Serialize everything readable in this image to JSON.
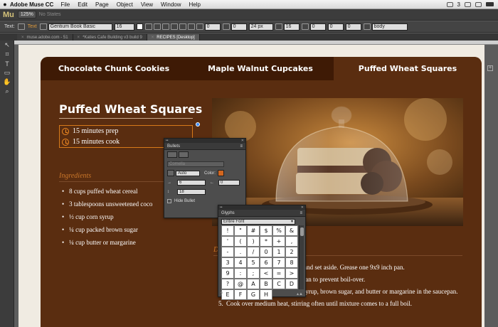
{
  "menubar": {
    "apple": "",
    "app_name": "Adobe Muse CC",
    "menus": [
      "File",
      "Edit",
      "Page",
      "Object",
      "View",
      "Window",
      "Help"
    ],
    "status_icons": [
      "bluetooth-icon",
      "wifi-icon",
      "volume-icon",
      "battery-icon"
    ],
    "ab_badge": "3"
  },
  "appbar": {
    "logo": "Mu",
    "zoom": "125%",
    "states": "No States"
  },
  "textbar": {
    "label": "Text:",
    "style_label": "Text",
    "font": "Gentium Book Basic",
    "size": "16",
    "field_a": "0",
    "field_b": "0",
    "leading": "24 px",
    "field_c": "16",
    "field_d": "0",
    "field_e": "0",
    "field_f": "0",
    "tag": "body"
  },
  "doctabs": [
    {
      "label": "muse.adobe.com - 51",
      "active": false
    },
    {
      "label": "*Katies Cafe Building v3 build 9",
      "active": false
    },
    {
      "label": "RECIPES [Desktop]",
      "active": true
    }
  ],
  "tools": [
    "selection-tool-icon",
    "crop-tool-icon",
    "text-tool-icon",
    "rectangle-tool-icon",
    "hand-tool-icon",
    "zoom-tool-icon"
  ],
  "tool_glyphs": [
    "↖",
    "⌗",
    "T",
    "▭",
    "✋",
    "⌕"
  ],
  "recipe": {
    "tabs": [
      "Chocolate Chunk Cookies",
      "Maple Walnut Cupcakes",
      "Puffed Wheat Squares"
    ],
    "active_tab": 2,
    "title": "Puffed Wheat Squares",
    "prep": "15 minutes prep",
    "cook": "15 minutes cook",
    "ingredients_heading": "Ingredients",
    "ingredients": [
      "8 cups puffed wheat cereal",
      "3 tablespoons unsweetened coco",
      "½ cup corn syrup",
      "¼ cup packed brown sugar",
      "¼ cup butter or margarine"
    ],
    "directions_heading": "D",
    "directions": [
      {
        "num": "",
        "text": "rge bowl, and set aside. Grease one 9x9 inch pan."
      },
      {
        "num": "",
        "text": "um saucepan to prevent boil-over."
      },
      {
        "num": "4.",
        "text": "Place the cocoa powder, corn syrup, brown sugar, and butter or margarine in the saucepan."
      },
      {
        "num": "5.",
        "text": "Cook over medium heat, stirring often until mixture comes to a full boil."
      }
    ]
  },
  "bullets_panel": {
    "title": "Bullets",
    "type": "Auto",
    "disabled_field": "Comella",
    "color_label": "Color:",
    "indent_value": "6",
    "spacing_value": "18",
    "right_value": "0",
    "hide_label": "Hide Bullet",
    "color_swatch": "#d2661e"
  },
  "glyphs_panel": {
    "title": "Glyphs",
    "font_filter": "Entire Font",
    "glyphs": [
      "!",
      "\"",
      "#",
      "$",
      "%",
      "&",
      "'",
      "(",
      ")",
      "*",
      "+",
      ",",
      "-",
      ".",
      "/",
      "0",
      "1",
      "2",
      "3",
      "4",
      "5",
      "6",
      "7",
      "8",
      "9",
      ":",
      ";",
      "<",
      "=",
      ">",
      "?",
      "@",
      "A",
      "B",
      "C",
      "D",
      "E",
      "F",
      "G",
      "H"
    ],
    "footer_left": "?"
  },
  "colors": {
    "card_bg": "#5a2d10",
    "card_tab_inactive": "#3e1a05",
    "accent_orange": "#f28a22",
    "heading_orange": "#c9762a",
    "page_bg": "#f0ebe2"
  }
}
